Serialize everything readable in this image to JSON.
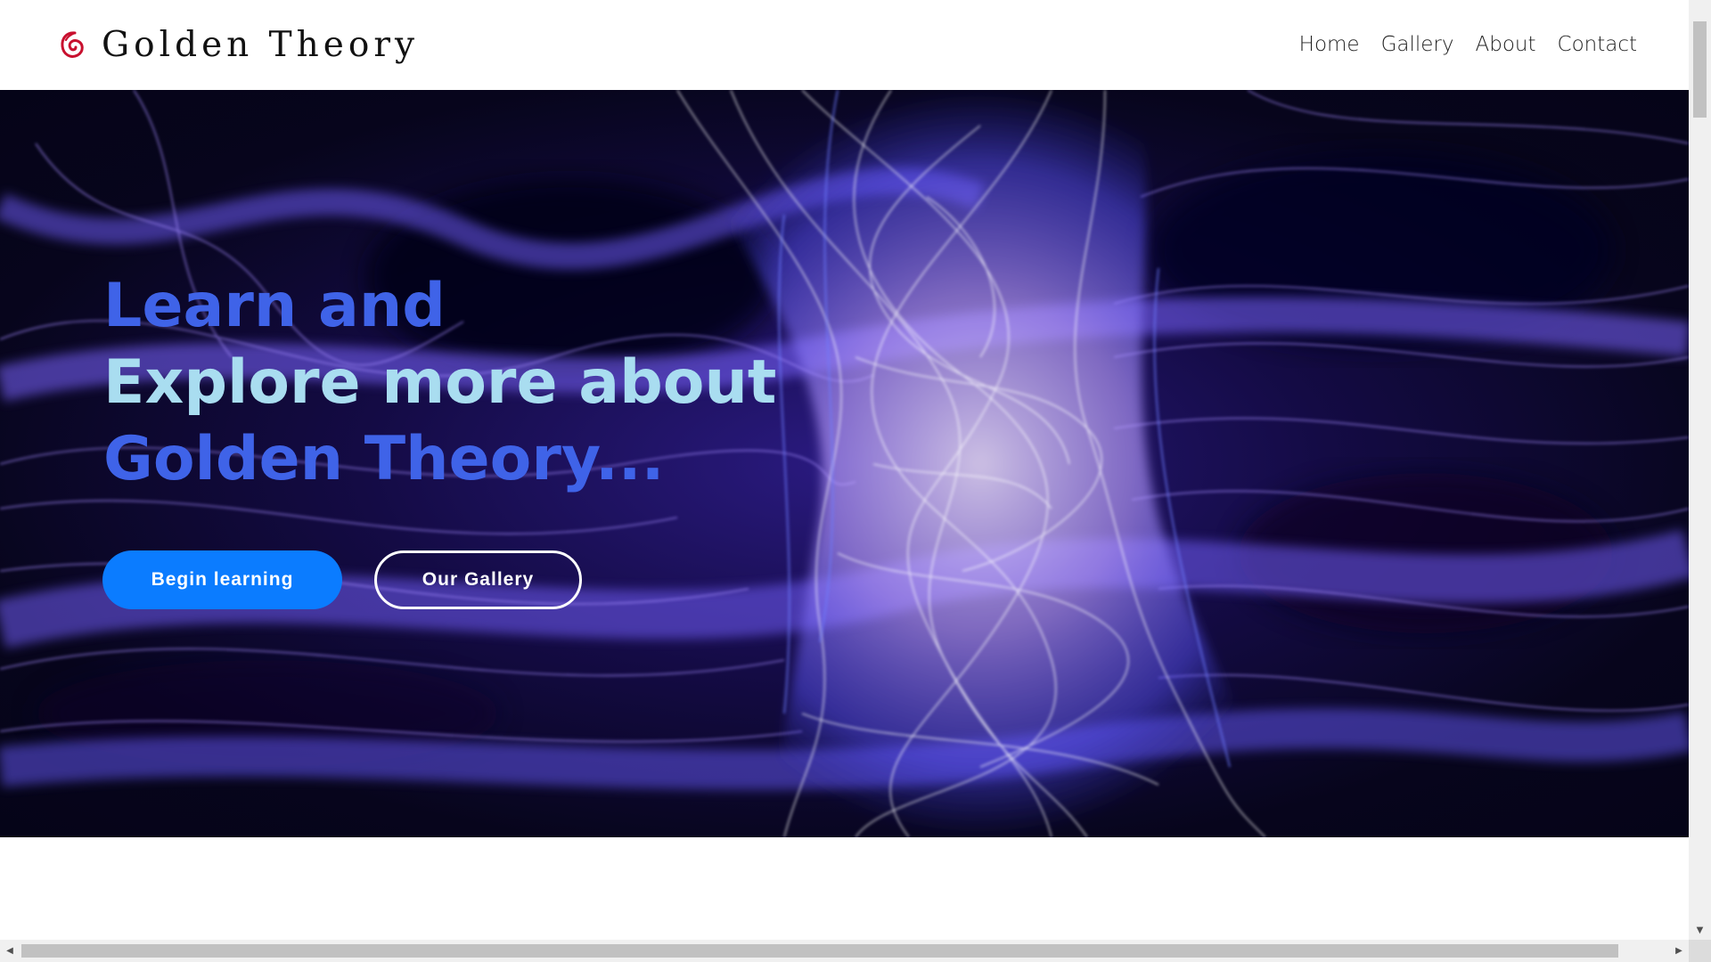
{
  "brand": {
    "name": "Golden Theory",
    "logo_icon": "spiral-swirl-icon",
    "logo_color": "#c8102e"
  },
  "nav": {
    "items": [
      {
        "label": "Home"
      },
      {
        "label": "Gallery"
      },
      {
        "label": "About"
      },
      {
        "label": "Contact"
      }
    ]
  },
  "hero": {
    "headline_line1": "Learn and",
    "headline_line2": "Explore more about",
    "headline_line3": "Golden Theory...",
    "primary_button": "Begin learning",
    "secondary_button": "Our Gallery",
    "colors": {
      "headline_blue": "#3f63e8",
      "headline_light": "#a9ddf0",
      "primary_button_bg": "#0b7cff",
      "background": "#140b45",
      "smoke": "#b49bff"
    }
  },
  "scrollbars": {
    "vertical_down_icon": "triangle-down-icon",
    "horizontal_left_icon": "triangle-left-icon",
    "horizontal_right_icon": "triangle-right-icon"
  }
}
